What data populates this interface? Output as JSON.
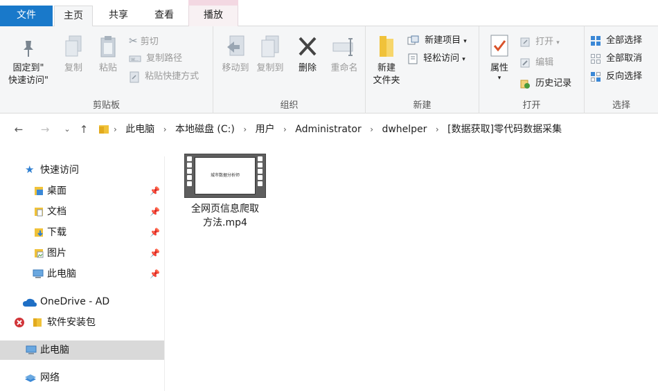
{
  "tabs": {
    "file": "文件",
    "home": "主页",
    "share": "共享",
    "view": "查看",
    "play": "播放"
  },
  "ribbon": {
    "clipboard": {
      "label": "剪贴板",
      "pin": "固定到\"\n快速访问\"",
      "pin_line1": "固定到\"",
      "pin_line2": "快速访问\"",
      "copy": "复制",
      "paste": "粘贴",
      "cut": "剪切",
      "copy_path": "复制路径",
      "paste_shortcut": "粘贴快捷方式"
    },
    "organize": {
      "label": "组织",
      "move_to": "移动到",
      "copy_to": "复制到",
      "delete": "删除",
      "rename": "重命名"
    },
    "new": {
      "label": "新建",
      "new_folder_line1": "新建",
      "new_folder_line2": "文件夹",
      "new_item": "新建项目",
      "easy_access": "轻松访问"
    },
    "open": {
      "label": "打开",
      "properties": "属性",
      "open": "打开",
      "edit": "编辑",
      "history": "历史记录"
    },
    "select": {
      "label": "选择",
      "select_all": "全部选择",
      "select_none": "全部取消",
      "invert": "反向选择"
    }
  },
  "address": {
    "crumbs": [
      "此电脑",
      "本地磁盘 (C:)",
      "用户",
      "Administrator",
      "dwhelper",
      "[数据获取]零代码数据采集"
    ]
  },
  "sidebar": {
    "quick_access": "快速访问",
    "items": [
      "桌面",
      "文档",
      "下载",
      "图片",
      "此电脑"
    ],
    "onedrive": "OneDrive - AD",
    "software": "软件安装包",
    "this_pc": "此电脑",
    "network": "网络"
  },
  "files": [
    {
      "name_line1": "全网页信息爬取",
      "name_line2": "方法.mp4",
      "thumb_text": "城市数据分析师"
    }
  ],
  "colors": {
    "file_tab": "#1979ca",
    "ribbon_bg": "#f5f6f7",
    "selected_nav": "#d9d9d9",
    "context_tab": "#f3d8e2"
  }
}
